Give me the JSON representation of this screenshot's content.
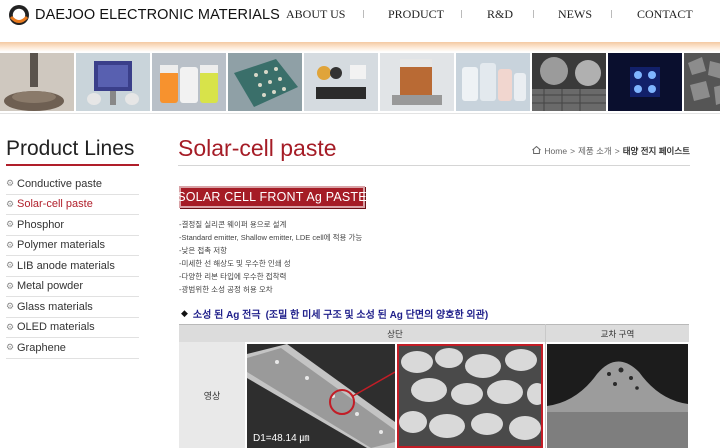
{
  "brand": {
    "name": "DAEJOO ELECTRONIC MATERIALS",
    "colors": {
      "accent": "#a51c26",
      "nav_text": "#222222",
      "header_bar": "#f4c9a2"
    }
  },
  "nav": {
    "items": [
      {
        "label": "ABOUT US"
      },
      {
        "label": "PRODUCT"
      },
      {
        "label": "R&D"
      },
      {
        "label": "NEWS"
      },
      {
        "label": "CONTACT"
      }
    ]
  },
  "strip": {
    "images": [
      {
        "icon": "paste-dispenser-photo"
      },
      {
        "icon": "solar-cell-photo"
      },
      {
        "icon": "phosphor-powder-photo"
      },
      {
        "icon": "circuit-board-photo"
      },
      {
        "icon": "anode-material-photo"
      },
      {
        "icon": "metal-powder-photo"
      },
      {
        "icon": "glass-vials-photo"
      },
      {
        "icon": "micro-sphere-photo"
      },
      {
        "icon": "oled-device-photo"
      },
      {
        "icon": "graphene-micrograph-photo"
      }
    ]
  },
  "sidebar": {
    "title": "Product Lines",
    "items": [
      {
        "label": "Conductive paste",
        "active": false
      },
      {
        "label": "Solar-cell paste",
        "active": true
      },
      {
        "label": "Phosphor",
        "active": false
      },
      {
        "label": "Polymer materials",
        "active": false
      },
      {
        "label": "LIB anode materials",
        "active": false
      },
      {
        "label": "Metal powder",
        "active": false
      },
      {
        "label": "Glass materials",
        "active": false
      },
      {
        "label": "OLED materials",
        "active": false
      },
      {
        "label": "Graphene",
        "active": false
      }
    ]
  },
  "main": {
    "title": "Solar-cell paste",
    "breadcrumb": {
      "home": "Home",
      "sep": ">",
      "parent": "제품 소개",
      "current": "태양 전지 페이스트"
    },
    "badge": "SOLAR CELL FRONT Ag PASTE",
    "features": [
      "-결정질 실리콘 웨이퍼 용으로 설계",
      "-Standard emitter, Shallow emitter, LDE cell에 적용 가능",
      "-낮은 접촉 저항",
      "-미세한 선 해상도 및 우수한 인쇄 성",
      "-다양한 리본 타입에 우수한 접착력",
      "-광범위한 소성 공정 허용 오차"
    ],
    "section": {
      "bullet": "◆",
      "title": "소성 된 Ag 전극",
      "note": "(조밀 한 미세 구조 및 소성 된 Ag 단면의 양호한 외관)"
    },
    "table": {
      "headers": [
        "상단",
        "교차 구역"
      ],
      "row_label": "영상",
      "scale_label": "D1=48.14 ㎛"
    }
  }
}
